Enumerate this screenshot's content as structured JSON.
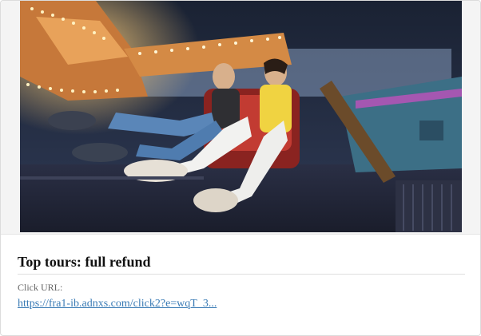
{
  "card": {
    "title": "Top tours: full refund",
    "click_url_label": "Click URL:",
    "click_url": "https://fra1-ib.adnxs.com/click2?e=wqT_3..."
  },
  "image": {
    "subject": "amusement-ride-photo"
  }
}
